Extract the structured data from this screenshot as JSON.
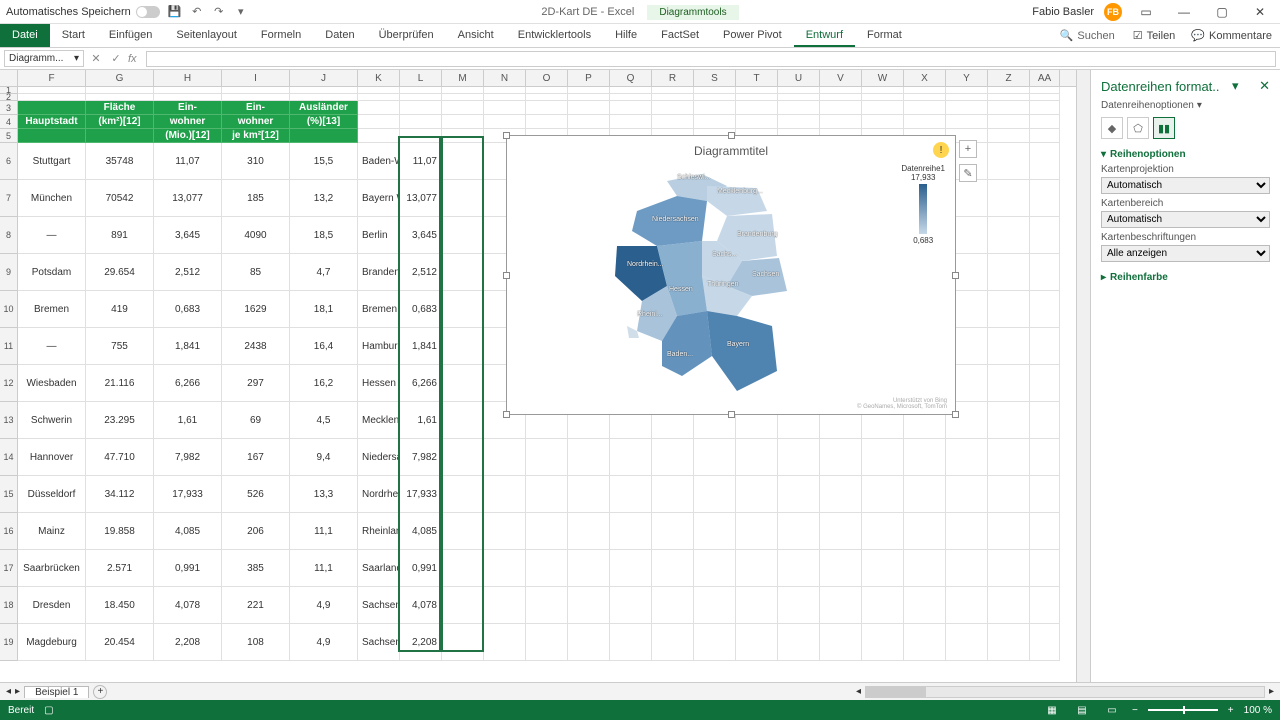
{
  "title": {
    "autosave": "Automatisches Speichern",
    "doc": "2D-Kart DE - Excel",
    "tools": "Diagrammtools",
    "user": "Fabio Basler",
    "initials": "FB"
  },
  "ribbon": {
    "tabs": [
      "Datei",
      "Start",
      "Einfügen",
      "Seitenlayout",
      "Formeln",
      "Daten",
      "Überprüfen",
      "Ansicht",
      "Entwicklertools",
      "Hilfe",
      "FactSet",
      "Power Pivot",
      "Entwurf",
      "Format"
    ],
    "search": "Suchen",
    "share": "Teilen",
    "comments": "Kommentare"
  },
  "namebox": "Diagramm...",
  "cols": [
    "F",
    "G",
    "H",
    "I",
    "J",
    "K",
    "L",
    "M",
    "N",
    "O",
    "P",
    "Q",
    "R",
    "S",
    "T",
    "U",
    "V",
    "W",
    "X",
    "Y",
    "Z",
    "AA"
  ],
  "headers": {
    "F": "Hauptstadt",
    "G1": "Fläche",
    "G2": "(km²)[12]",
    "H1": "Ein-",
    "H2": "wohner",
    "H3": "(Mio.)[12]",
    "I1": "Ein-",
    "I2": "wohner",
    "I3": "je km²[12]",
    "J1": "Ausländer",
    "J2": "(%)[13]"
  },
  "rows": [
    {
      "n": "6",
      "F": "Stuttgart",
      "G": "35748",
      "H": "11,07",
      "I": "310",
      "J": "15,5",
      "K": "Baden-Wü",
      "L": "11,07"
    },
    {
      "n": "7",
      "F": "München",
      "G": "70542",
      "H": "13,077",
      "I": "185",
      "J": "13,2",
      "K": "Bayern W",
      "L": "13,077"
    },
    {
      "n": "8",
      "F": "—",
      "G": "891",
      "H": "3,645",
      "I": "4090",
      "J": "18,5",
      "K": "Berlin",
      "L": "3,645"
    },
    {
      "n": "9",
      "F": "Potsdam",
      "G": "29.654",
      "H": "2,512",
      "I": "85",
      "J": "4,7",
      "K": "Brandenb",
      "L": "2,512"
    },
    {
      "n": "10",
      "F": "Bremen",
      "G": "419",
      "H": "0,683",
      "I": "1629",
      "J": "18,1",
      "K": "Bremen",
      "L": "0,683"
    },
    {
      "n": "11",
      "F": "—",
      "G": "755",
      "H": "1,841",
      "I": "2438",
      "J": "16,4",
      "K": "Hamburg",
      "L": "1,841"
    },
    {
      "n": "12",
      "F": "Wiesbaden",
      "G": "21.116",
      "H": "6,266",
      "I": "297",
      "J": "16,2",
      "K": "Hessen",
      "L": "6,266"
    },
    {
      "n": "13",
      "F": "Schwerin",
      "G": "23.295",
      "H": "1,61",
      "I": "69",
      "J": "4,5",
      "K": "Mecklenb",
      "L": "1,61"
    },
    {
      "n": "14",
      "F": "Hannover",
      "G": "47.710",
      "H": "7,982",
      "I": "167",
      "J": "9,4",
      "K": "Niedersac",
      "L": "7,982"
    },
    {
      "n": "15",
      "F": "Düsseldorf",
      "G": "34.112",
      "H": "17,933",
      "I": "526",
      "J": "13,3",
      "K": "Nordrhein",
      "L": "17,933"
    },
    {
      "n": "16",
      "F": "Mainz",
      "G": "19.858",
      "H": "4,085",
      "I": "206",
      "J": "11,1",
      "K": "Rheinland",
      "L": "4,085"
    },
    {
      "n": "17",
      "F": "Saarbrücken",
      "G": "2.571",
      "H": "0,991",
      "I": "385",
      "J": "11,1",
      "K": "Saarland",
      "L": "0,991"
    },
    {
      "n": "18",
      "F": "Dresden",
      "G": "18.450",
      "H": "4,078",
      "I": "221",
      "J": "4,9",
      "K": "Sachsen",
      "L": "4,078"
    },
    {
      "n": "19",
      "F": "Magdeburg",
      "G": "20.454",
      "H": "2,208",
      "I": "108",
      "J": "4,9",
      "K": "Sachsen-A",
      "L": "2,208"
    }
  ],
  "chart": {
    "title": "Diagrammtitel",
    "legend_label": "Datenreihe1",
    "legend_max": "17,933",
    "legend_min": "0,683",
    "credit1": "Unterstützt von Bing",
    "credit2": "© GeoNames, Microsoft, TomTom",
    "labels": [
      "Schleswi...",
      "Mecklenburg...",
      "Niedersachsen",
      "Brandenburg",
      "Sachs...",
      "Sachsen",
      "Thüringen",
      "Hessen",
      "Nordrhein...",
      "Rheinl...",
      "Baden...",
      "Bayern"
    ]
  },
  "pane": {
    "title": "Datenreihen format..",
    "sub": "Datenreihenoptionen",
    "sec1": "Reihenoptionen",
    "l1": "Kartenprojektion",
    "v1": "Automatisch",
    "l2": "Kartenbereich",
    "v2": "Automatisch",
    "l3": "Kartenbeschriftungen",
    "v3": "Alle anzeigen",
    "sec2": "Reihenfarbe"
  },
  "sheet": {
    "tab": "Beispiel 1",
    "status": "Bereit",
    "zoom": "100 %"
  },
  "chart_data": {
    "type": "map",
    "title": "Diagrammtitel",
    "series_name": "Datenreihe1",
    "color_min": "#c6d8e8",
    "color_max": "#2b5f8e",
    "value_min": 0.683,
    "value_max": 17.933,
    "regions": [
      {
        "name": "Baden-Württemberg",
        "value": 11.07
      },
      {
        "name": "Bayern",
        "value": 13.077
      },
      {
        "name": "Berlin",
        "value": 3.645
      },
      {
        "name": "Brandenburg",
        "value": 2.512
      },
      {
        "name": "Bremen",
        "value": 0.683
      },
      {
        "name": "Hamburg",
        "value": 1.841
      },
      {
        "name": "Hessen",
        "value": 6.266
      },
      {
        "name": "Mecklenburg-Vorpommern",
        "value": 1.61
      },
      {
        "name": "Niedersachsen",
        "value": 7.982
      },
      {
        "name": "Nordrhein-Westfalen",
        "value": 17.933
      },
      {
        "name": "Rheinland-Pfalz",
        "value": 4.085
      },
      {
        "name": "Saarland",
        "value": 0.991
      },
      {
        "name": "Sachsen",
        "value": 4.078
      },
      {
        "name": "Sachsen-Anhalt",
        "value": 2.208
      }
    ]
  }
}
